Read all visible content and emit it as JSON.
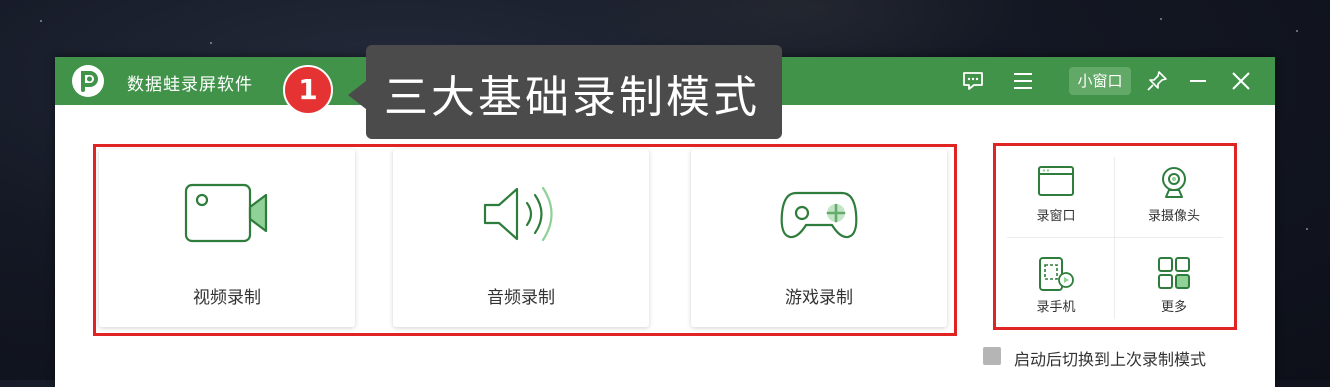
{
  "app": {
    "title": "数据蛙录屏软件",
    "mini_window_label": "小窗口"
  },
  "annotation": {
    "badge_number": "1",
    "callout_text": "三大基础录制模式"
  },
  "modes": [
    {
      "label": "视频录制",
      "icon": "video-camera-icon"
    },
    {
      "label": "音频录制",
      "icon": "speaker-icon"
    },
    {
      "label": "游戏录制",
      "icon": "gamepad-icon"
    }
  ],
  "tools": [
    {
      "label": "录窗口",
      "icon": "window-icon"
    },
    {
      "label": "录摄像头",
      "icon": "webcam-icon"
    },
    {
      "label": "录手机",
      "icon": "phone-icon"
    },
    {
      "label": "更多",
      "icon": "grid-icon"
    }
  ],
  "footer": {
    "checkbox_label": "启动后切换到上次录制模式",
    "checked": false
  },
  "colors": {
    "brand_green": "#41934a",
    "icon_green": "#2f7d3c",
    "accent_green": "#8fd196",
    "highlight_red": "#e02424",
    "badge_red": "#e53333"
  }
}
